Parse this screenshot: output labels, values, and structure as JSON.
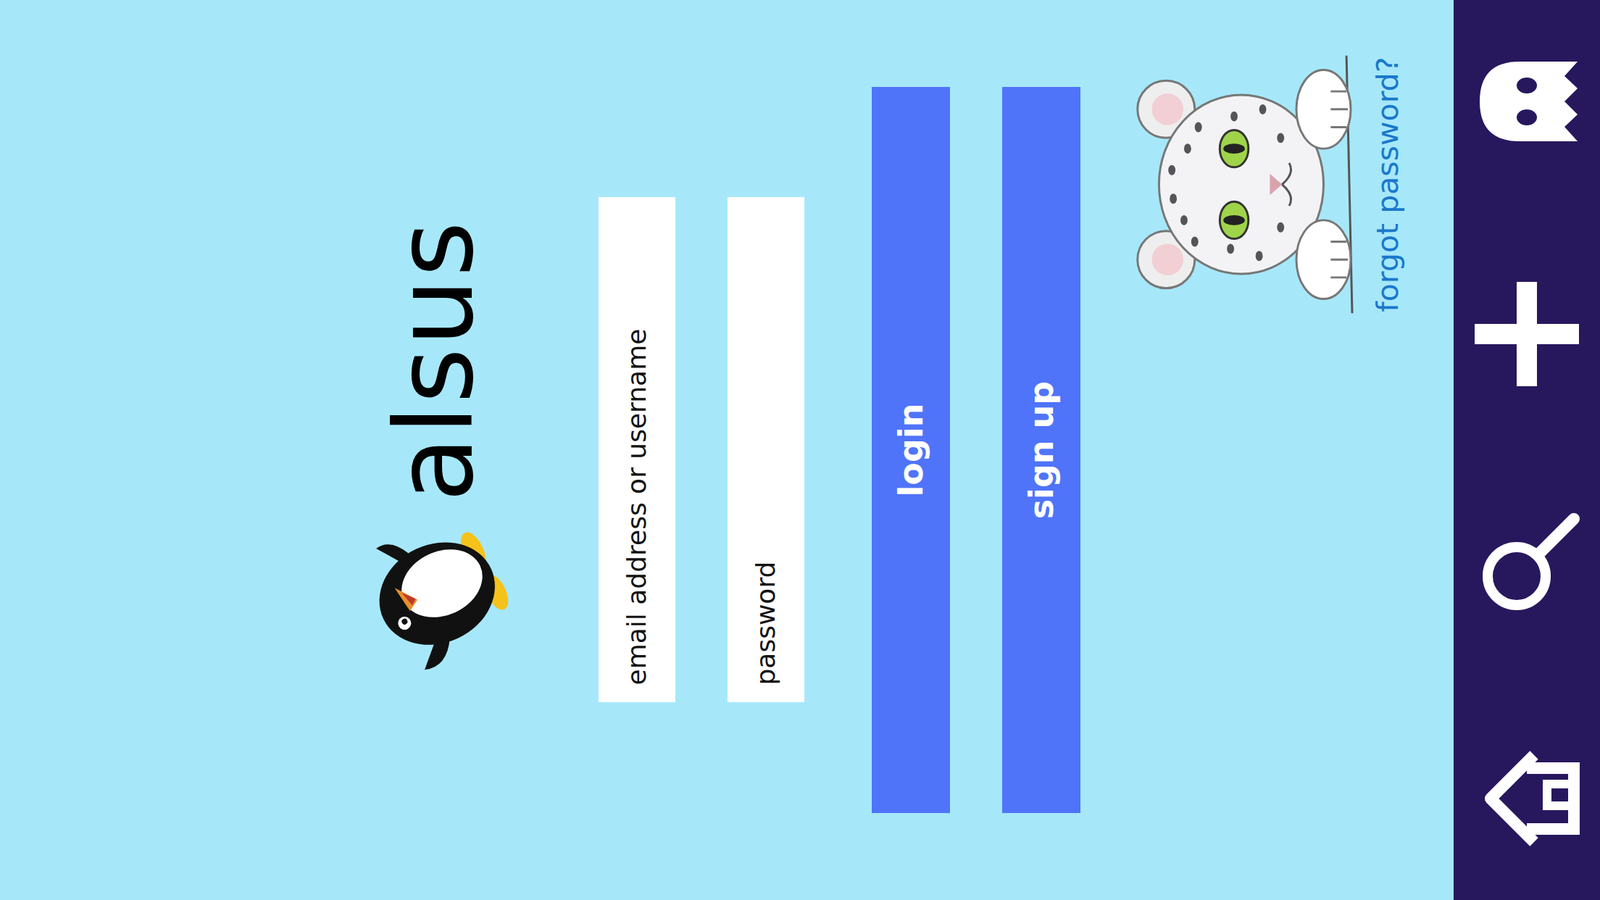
{
  "logo": {
    "text": "alsus"
  },
  "form": {
    "fields": [
      {
        "placeholder": "email address or username",
        "kind": "text"
      },
      {
        "placeholder": "password",
        "kind": "password"
      }
    ],
    "buttons": [
      "login",
      "sign up"
    ],
    "forgot": "forgot password?"
  }
}
